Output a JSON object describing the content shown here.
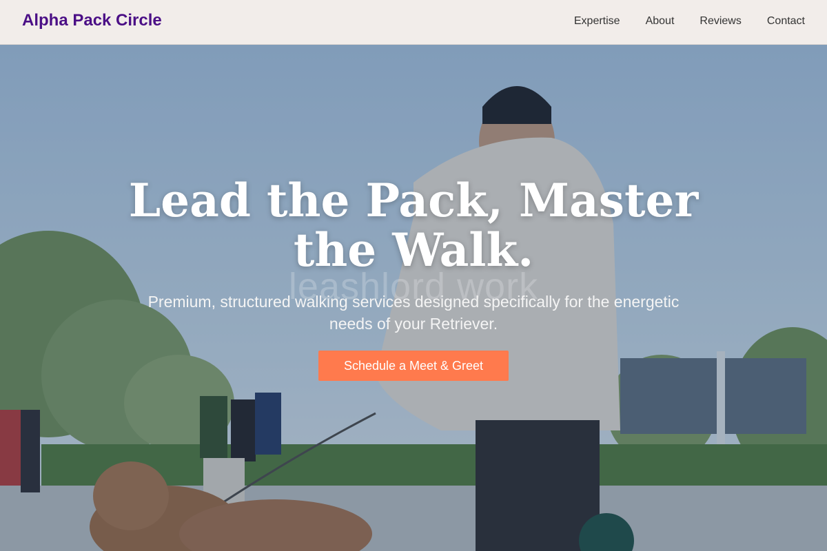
{
  "nav": {
    "brand": "Alpha Pack Circle",
    "links": [
      "Expertise",
      "About",
      "Reviews",
      "Contact"
    ]
  },
  "hero": {
    "headline": "Lead the Pack, Master the Walk.",
    "watermark": "leashlord work",
    "subtitle": "Premium, structured walking services designed specifically for the energetic needs of your Retriever.",
    "cta": "Schedule a Meet & Greet"
  },
  "colors": {
    "brand": "#4b0f86",
    "accent": "#ff7a4d",
    "nav_bg": "#f2edea"
  }
}
